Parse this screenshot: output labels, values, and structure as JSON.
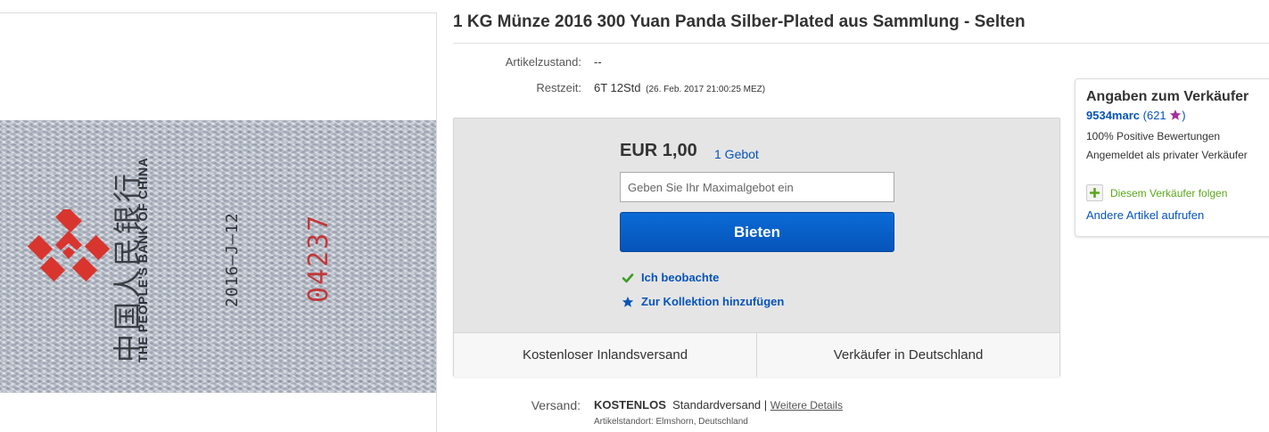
{
  "item": {
    "title": "1 KG Münze 2016 300 Yuan Panda Silber-Plated aus Sammlung - Selten",
    "image": {
      "bank_name_cn": "中国人民银行",
      "bank_name_en": "THE PEOPLE'S BANK OF CHINA",
      "date_code": "2016—J—12",
      "serial": "04237",
      "logo_color": "#d9352f"
    }
  },
  "details": {
    "condition_label": "Artikelzustand:",
    "condition_value": "--",
    "time_label": "Restzeit:",
    "time_value": "6T 12Std",
    "time_end": "(26. Feb. 2017   21:00:25 MEZ)"
  },
  "bid": {
    "price": "EUR 1,00",
    "bid_count": "1 Gebot",
    "input_placeholder": "Geben Sie Ihr Maximalgebot ein",
    "button_label": "Bieten",
    "watch_label": "Ich beobachte",
    "collection_label": "Zur Kollektion hinzufügen",
    "footer_left": "Kostenloser Inlandsversand",
    "footer_right": "Verkäufer in Deutschland"
  },
  "shipping": {
    "label": "Versand:",
    "cost": "KOSTENLOS",
    "method": "Standardversand",
    "separator": "|",
    "details_link": "Weitere Details",
    "location": "Artikelstandort:  Elmshorn, Deutschland"
  },
  "seller": {
    "heading": "Angaben zum Verkäufer",
    "name": "9534marc",
    "open_paren": "(",
    "feedback_count": "621",
    "close_paren": ")",
    "positive": "100% Positive Bewertungen",
    "registered": "Angemeldet als privater Verkäufer",
    "follow_label": "Diesem Verkäufer folgen",
    "other_items": "Andere Artikel aufrufen"
  },
  "colors": {
    "link_blue": "#0654ba",
    "button_blue": "#0654ba",
    "follow_green": "#5ba71b",
    "star_purple": "#a22e9c",
    "check_green": "#3c9b23"
  },
  "icons": {
    "watch": "check-icon",
    "collection": "star-icon",
    "follow": "plus-icon",
    "rating": "star-icon"
  }
}
